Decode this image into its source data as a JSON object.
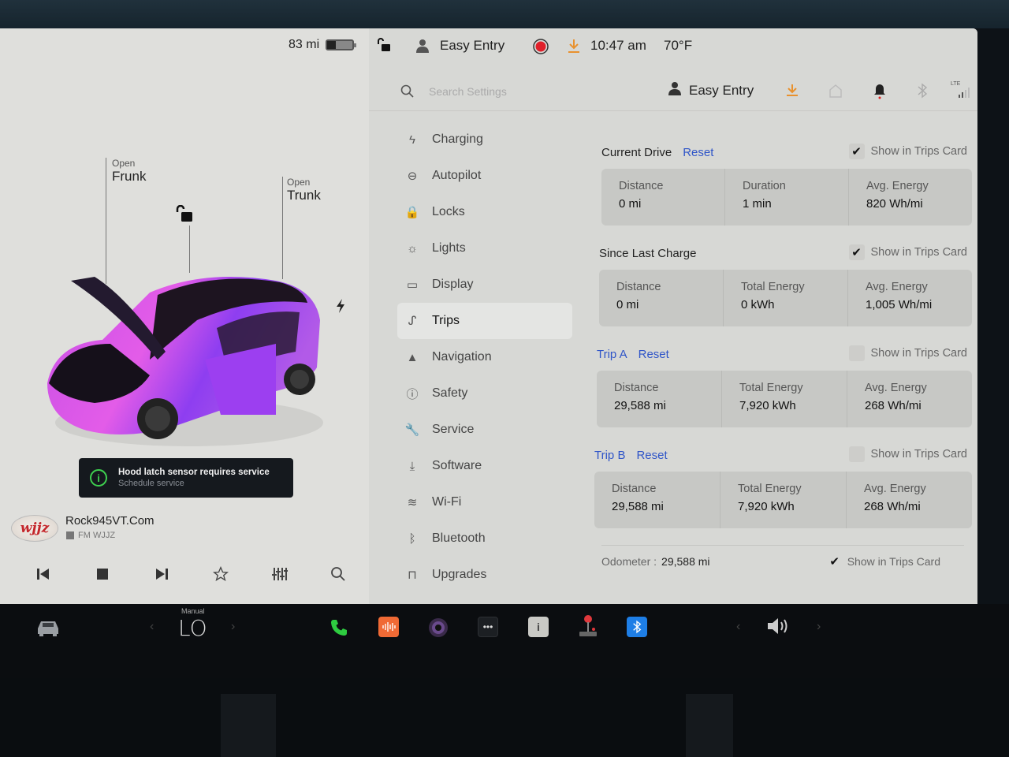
{
  "status_bar": {
    "range": "83 mi",
    "battery_level_fraction": 0.35,
    "profile": "Easy Entry",
    "time": "10:47 am",
    "temperature": "70°F",
    "icons": [
      "lock-open-icon",
      "person-icon",
      "dashcam-record-icon",
      "download-icon"
    ]
  },
  "car_panel": {
    "frunk": {
      "action": "Open",
      "label": "Frunk"
    },
    "trunk": {
      "action": "Open",
      "label": "Trunk"
    },
    "icons": [
      "unlock-icon",
      "charge-port-icon"
    ],
    "car_color": "#b34ee0"
  },
  "alert": {
    "title": "Hood latch sensor requires service",
    "action": "Schedule service",
    "icon": "info-icon",
    "icon_color": "#3ecf4f"
  },
  "media": {
    "logo_text": "wjjz",
    "station": "Rock945VT.Com",
    "band": "FM WJJZ",
    "controls": [
      "previous-icon",
      "stop-icon",
      "next-icon",
      "favorite-icon",
      "equalizer-icon",
      "search-icon"
    ]
  },
  "settings": {
    "search_placeholder": "Search Settings",
    "profile": "Easy Entry",
    "header_icons": [
      "download-icon",
      "homelink-icon",
      "notification-bell-icon",
      "bluetooth-icon",
      "lte-signal-icon"
    ],
    "lte_label": "LTE",
    "nav": [
      {
        "label": "Charging",
        "icon": "charging-icon",
        "glyph": "ϟ"
      },
      {
        "label": "Autopilot",
        "icon": "steering-wheel-icon",
        "glyph": "⊖"
      },
      {
        "label": "Locks",
        "icon": "lock-icon",
        "glyph": "🔒"
      },
      {
        "label": "Lights",
        "icon": "lights-icon",
        "glyph": "☼"
      },
      {
        "label": "Display",
        "icon": "display-icon",
        "glyph": "▭"
      },
      {
        "label": "Trips",
        "icon": "trips-icon",
        "glyph": "ᔑ",
        "active": true
      },
      {
        "label": "Navigation",
        "icon": "navigation-icon",
        "glyph": "▲"
      },
      {
        "label": "Safety",
        "icon": "safety-icon",
        "glyph": "ⓘ"
      },
      {
        "label": "Service",
        "icon": "wrench-icon",
        "glyph": "🔧"
      },
      {
        "label": "Software",
        "icon": "software-download-icon",
        "glyph": "⤓"
      },
      {
        "label": "Wi-Fi",
        "icon": "wifi-icon",
        "glyph": "≋"
      },
      {
        "label": "Bluetooth",
        "icon": "bluetooth-icon",
        "glyph": "ᛒ"
      },
      {
        "label": "Upgrades",
        "icon": "shopping-bag-icon",
        "glyph": "⊓"
      }
    ]
  },
  "trips": {
    "reset_label": "Reset",
    "show_in_card_label": "Show in Trips Card",
    "sections": [
      {
        "title": "Current Drive",
        "has_reset": true,
        "title_blue": false,
        "show_in_card": true,
        "stats": [
          {
            "label": "Distance",
            "value": "0 mi"
          },
          {
            "label": "Duration",
            "value": "1 min"
          },
          {
            "label": "Avg. Energy",
            "value": "820 Wh/mi"
          }
        ]
      },
      {
        "title": "Since Last Charge",
        "has_reset": false,
        "title_blue": false,
        "show_in_card": true,
        "stats": [
          {
            "label": "Distance",
            "value": "0 mi"
          },
          {
            "label": "Total Energy",
            "value": "0 kWh"
          },
          {
            "label": "Avg. Energy",
            "value": "1,005 Wh/mi"
          }
        ]
      },
      {
        "title": "Trip A",
        "has_reset": true,
        "title_blue": true,
        "show_in_card": false,
        "stats": [
          {
            "label": "Distance",
            "value": "29,588 mi"
          },
          {
            "label": "Total Energy",
            "value": "7,920 kWh"
          },
          {
            "label": "Avg. Energy",
            "value": "268 Wh/mi"
          }
        ]
      },
      {
        "title": "Trip B",
        "has_reset": true,
        "title_blue": true,
        "show_in_card": false,
        "stats": [
          {
            "label": "Distance",
            "value": "29,588 mi"
          },
          {
            "label": "Total Energy",
            "value": "7,920 kWh"
          },
          {
            "label": "Avg. Energy",
            "value": "268 Wh/mi"
          }
        ]
      }
    ],
    "odometer": {
      "label": "Odometer :",
      "value": "29,588 mi",
      "show_in_card": true
    }
  },
  "taskbar": {
    "climate_mode": "Manual",
    "climate_value": "LO",
    "apps": [
      {
        "name": "car-icon"
      },
      {
        "name": "phone-icon",
        "color": "#2ecc40"
      },
      {
        "name": "audio-app-icon",
        "color": "#f06a35"
      },
      {
        "name": "camera-icon",
        "color": "#6a4a8c"
      },
      {
        "name": "more-apps-icon",
        "color": "#2a2d31"
      },
      {
        "name": "notepad-icon",
        "color": "#c9c9c5"
      },
      {
        "name": "arcade-joystick-icon",
        "color": "#e0383c"
      },
      {
        "name": "bluetooth-app-icon",
        "color": "#1e7ee6"
      },
      {
        "name": "volume-icon"
      }
    ]
  },
  "colors": {
    "accent_blue": "#2f55c8",
    "record_red": "#e0202a",
    "download_orange": "#e8912e"
  }
}
